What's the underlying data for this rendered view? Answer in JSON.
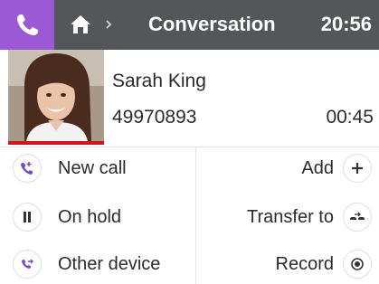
{
  "header": {
    "title": "Conversation",
    "time": "20:56",
    "accent_color": "#9b59d4",
    "bar_color": "#54575a",
    "icons": [
      "phone-handset-icon",
      "home-icon",
      "chevron-right-icon"
    ]
  },
  "contact": {
    "name": "Sarah King",
    "number": "49970893",
    "duration": "00:45",
    "status_color": "#d0161c"
  },
  "actions_left": [
    {
      "label": "New call",
      "icon": "new-call-icon"
    },
    {
      "label": "On hold",
      "icon": "pause-icon"
    },
    {
      "label": "Other device",
      "icon": "other-device-icon"
    }
  ],
  "actions_right": [
    {
      "label": "Add",
      "icon": "plus-icon"
    },
    {
      "label": "Transfer to",
      "icon": "transfer-icon"
    },
    {
      "label": "Record",
      "icon": "record-icon"
    }
  ]
}
